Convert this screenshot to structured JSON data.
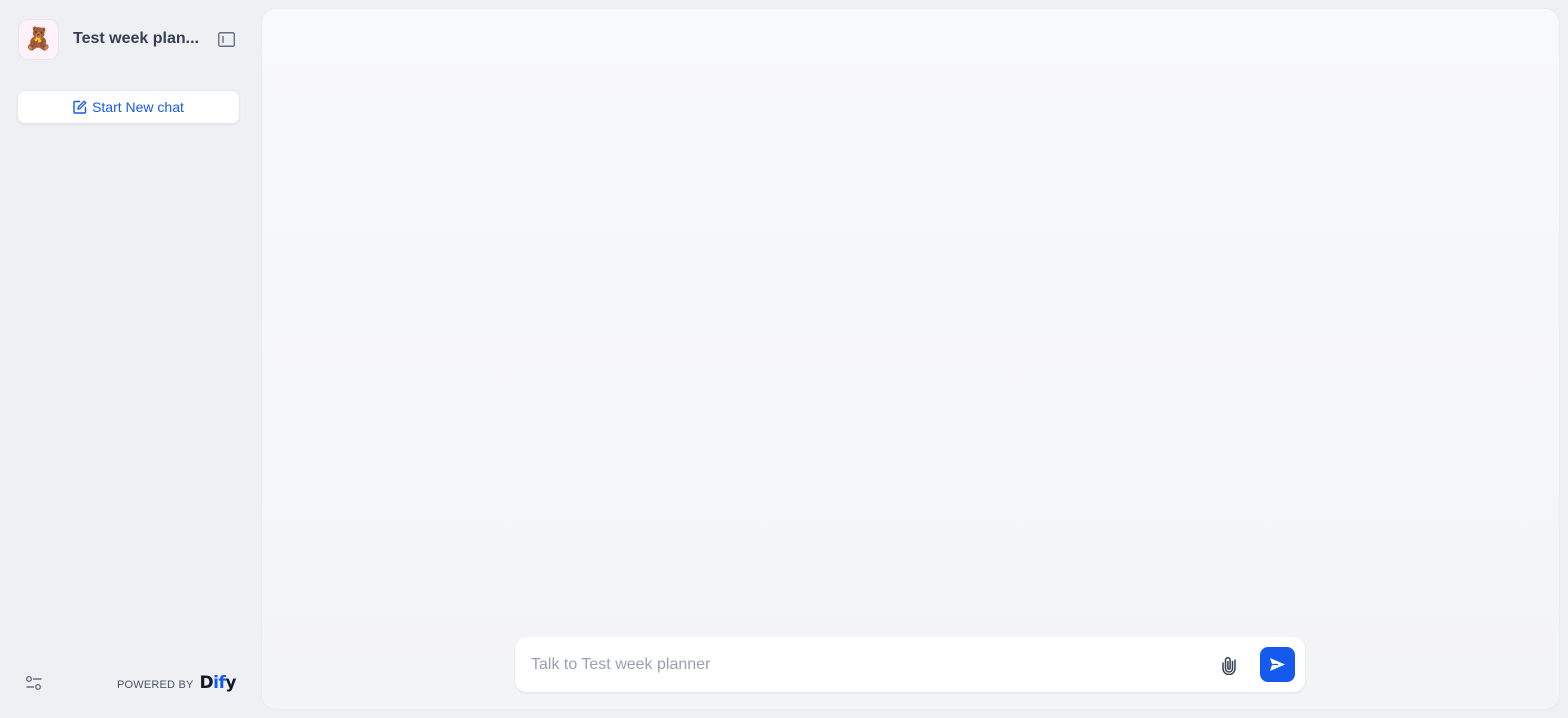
{
  "app": {
    "title": "Test week plan...",
    "avatar_emoji": "🧸"
  },
  "sidebar": {
    "new_chat_label": "Start New chat",
    "footer": {
      "powered_by": "POWERED BY",
      "brand_prefix": "D",
      "brand_accent": "if",
      "brand_suffix": "y"
    }
  },
  "chat": {
    "input_placeholder": "Talk to Test week planner",
    "input_value": ""
  },
  "icons": {
    "avatar": "teddy-bear-icon",
    "sidebar_toggle": "sidebar-panel-icon",
    "new_chat": "edit-square-icon",
    "settings": "sliders-icon",
    "attach": "paperclip-icon",
    "send": "send-arrow-icon"
  },
  "colors": {
    "accent": "#155aef",
    "background": "#eff0f4",
    "panel": "#f8f9fb",
    "placeholder": "#98a2b2"
  }
}
